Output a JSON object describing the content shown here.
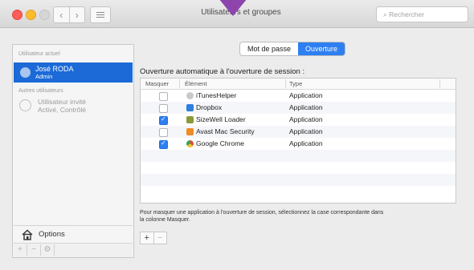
{
  "window": {
    "title": "Utilisateurs et groupes",
    "search_placeholder": "Rechercher"
  },
  "sidebar": {
    "current_user_header": "Utilisateur actuel",
    "current_user": {
      "name": "José RODA",
      "role": "Admin"
    },
    "other_users_header": "Autres utilisateurs",
    "guest": {
      "name": "Utilisateur invité",
      "status": "Activé, Contrôlé"
    },
    "options_label": "Options",
    "tools": [
      "+",
      "−",
      "⚙"
    ]
  },
  "tabs": [
    {
      "label": "Mot de passe",
      "active": false
    },
    {
      "label": "Ouverture",
      "active": true
    }
  ],
  "login_items": {
    "title": "Ouverture automatique à l'ouverture de session :",
    "columns": {
      "hide": "Masquer",
      "item": "Élément",
      "type": "Type"
    },
    "rows": [
      {
        "hidden": false,
        "name": "iTunesHelper",
        "type": "Application",
        "icon": "itunes-icon",
        "color": "#c9c9c9"
      },
      {
        "hidden": false,
        "name": "Dropbox",
        "type": "Application",
        "icon": "dropbox-icon",
        "color": "#2d7fe0"
      },
      {
        "hidden": true,
        "name": "SizeWell Loader",
        "type": "Application",
        "icon": "sizewell-icon",
        "color": "#8a9a3a"
      },
      {
        "hidden": false,
        "name": "Avast Mac Security",
        "type": "Application",
        "icon": "avast-icon",
        "color": "#f08a24"
      },
      {
        "hidden": true,
        "name": "Google Chrome",
        "type": "Application",
        "icon": "chrome-icon",
        "color": "#e04b3c"
      }
    ],
    "help_text": "Pour masquer une application à l'ouverture de session, sélectionnez la case correspondante dans la colonne Masquer.",
    "add_label": "+",
    "remove_label": "−"
  },
  "colors": {
    "accent": "#2e7ff2",
    "selection": "#1b6ad8",
    "pointer_arrow": "#8e44ad"
  }
}
